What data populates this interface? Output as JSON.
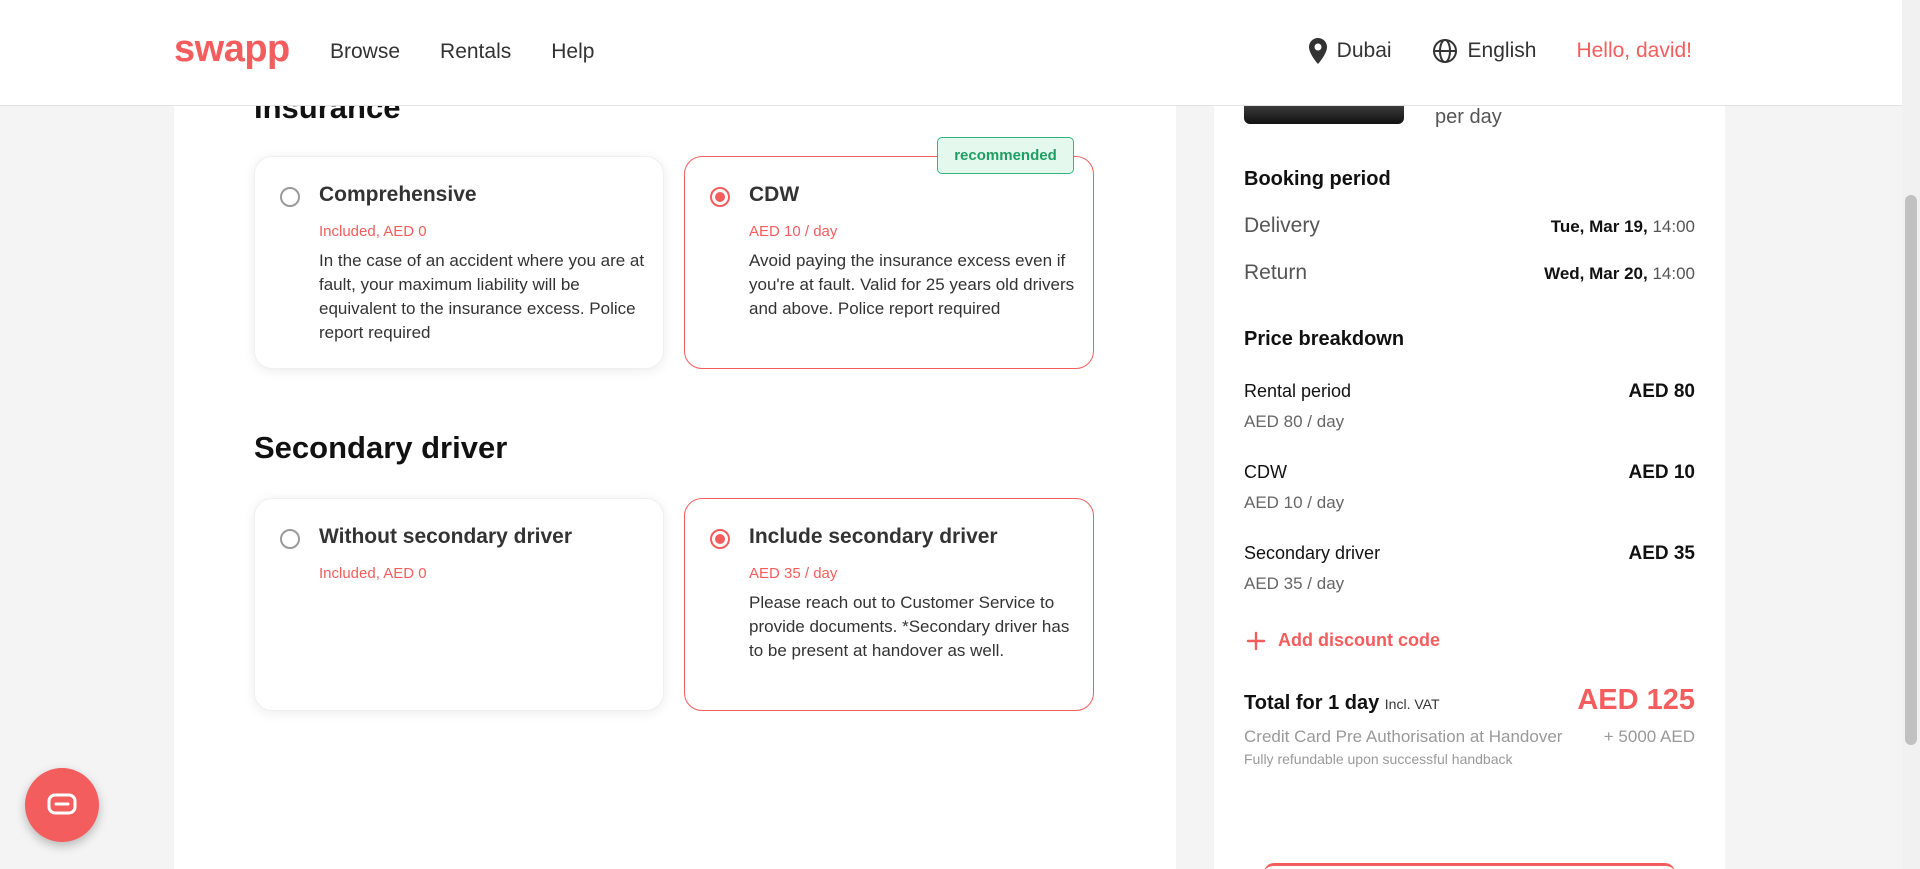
{
  "header": {
    "logo": "swapp",
    "nav": [
      "Browse",
      "Rentals",
      "Help"
    ],
    "city": "Dubai",
    "language": "English",
    "greeting": "Hello, david!"
  },
  "insurance": {
    "title": "Insurance",
    "options": [
      {
        "title": "Comprehensive",
        "price": "Included, AED 0",
        "description": "In the case of an accident where you are at fault, your maximum liability will be equivalent to the insurance excess. Police report required",
        "selected": false
      },
      {
        "title": "CDW",
        "price": "AED 10 / day",
        "description": "Avoid paying the insurance excess even if you're at fault. Valid for 25 years old drivers and above. Police report required",
        "badge": "recommended",
        "selected": true
      }
    ]
  },
  "secondary_driver": {
    "title": "Secondary driver",
    "options": [
      {
        "title": "Without secondary driver",
        "price": "Included, AED 0",
        "description": "",
        "selected": false
      },
      {
        "title": "Include secondary driver",
        "price": "AED 35 / day",
        "description": "Please reach out to Customer Service to provide documents. *Secondary driver has to be present at handover as well.",
        "selected": true
      }
    ]
  },
  "sidebar": {
    "per_day": "per day",
    "booking_period": {
      "title": "Booking period",
      "delivery_label": "Delivery",
      "delivery_date": "Tue, Mar 19,",
      "delivery_time": "14:00",
      "return_label": "Return",
      "return_date": "Wed, Mar 20,",
      "return_time": "14:00"
    },
    "price_breakdown": {
      "title": "Price breakdown",
      "items": [
        {
          "label": "Rental period",
          "amount": "AED 80",
          "sub": "AED 80 / day"
        },
        {
          "label": "CDW",
          "amount": "AED 10",
          "sub": "AED 10 / day"
        },
        {
          "label": "Secondary driver",
          "amount": "AED 35",
          "sub": "AED 35 / day"
        }
      ]
    },
    "discount_label": "Add discount code",
    "total_label": "Total for 1 day",
    "total_vat": "Incl. VAT",
    "total_amount": "AED 125",
    "credit_card_label": "Credit Card Pre Authorisation at Handover",
    "credit_card_amount": "+ 5000 AED",
    "credit_card_note": "Fully refundable upon successful handback"
  },
  "colors": {
    "brand": "#f35d5d",
    "recommended_green": "#36b37e"
  }
}
